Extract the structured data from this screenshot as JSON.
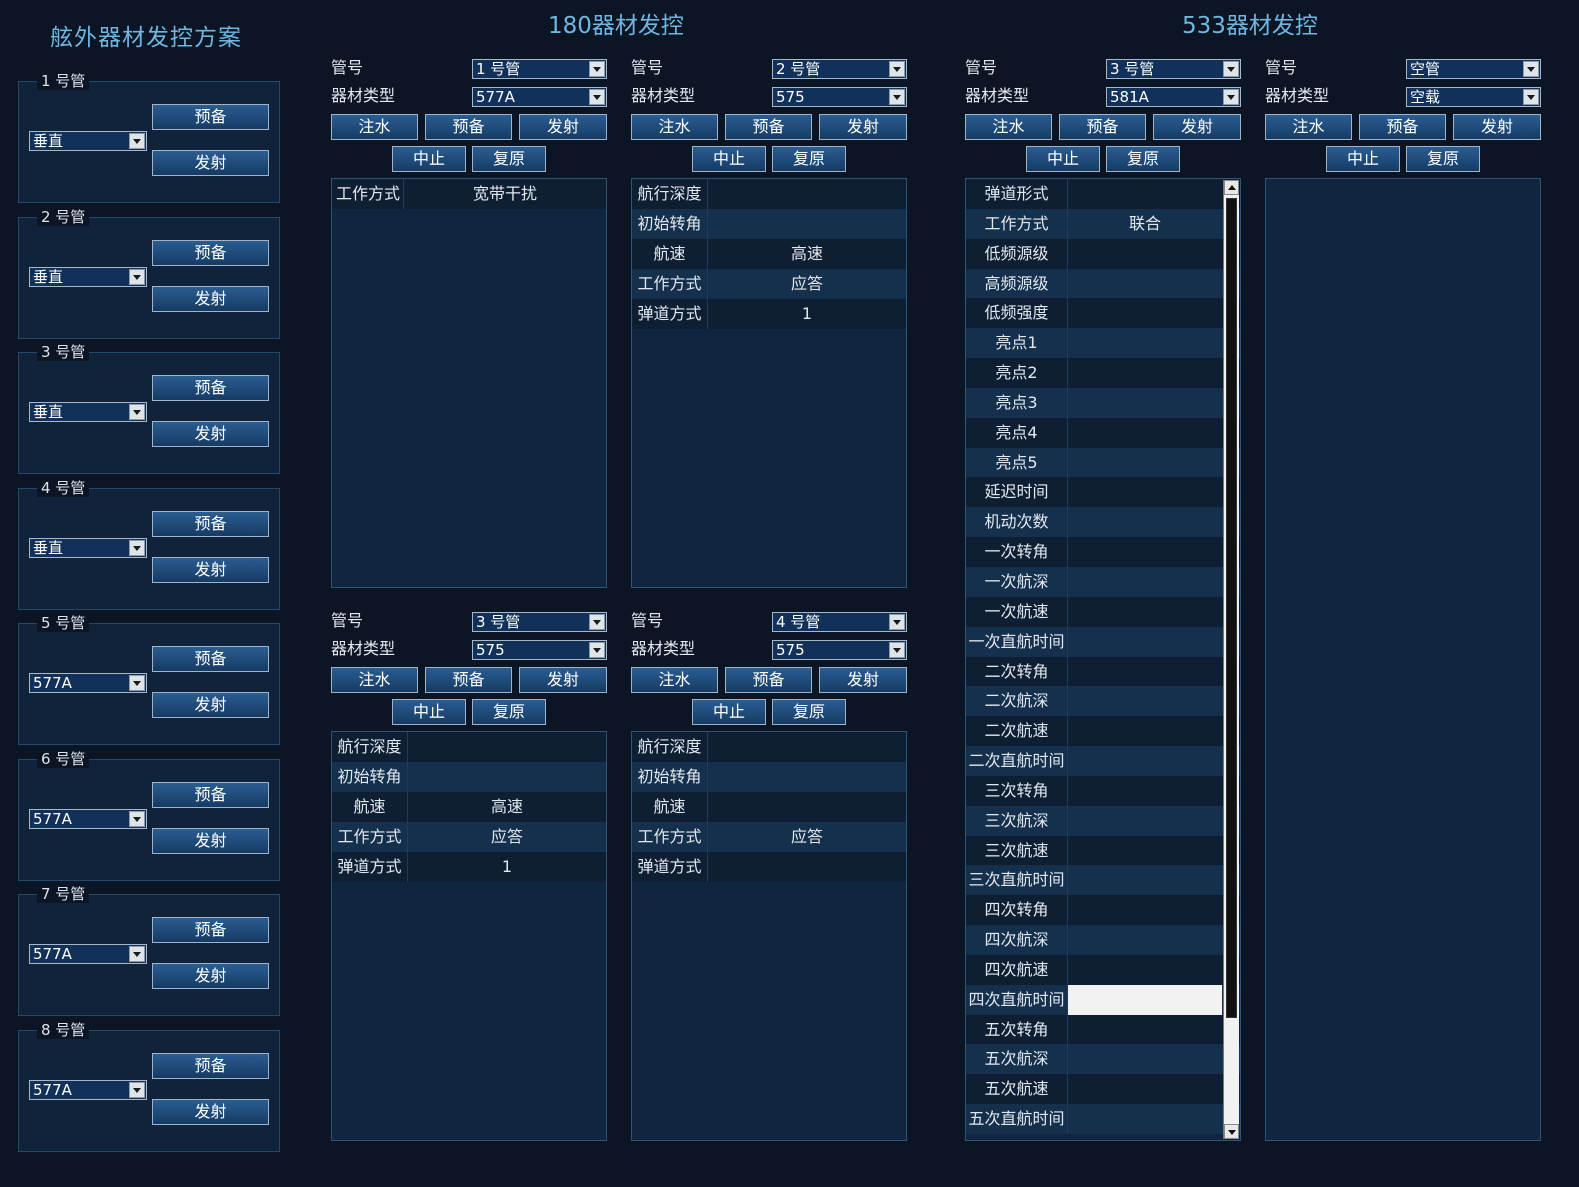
{
  "left_panel": {
    "title": "舷外器材发控方案",
    "tubes": [
      {
        "label": "1 号管",
        "mode": "垂直",
        "prepare": "预备",
        "launch": "发射"
      },
      {
        "label": "2 号管",
        "mode": "垂直",
        "prepare": "预备",
        "launch": "发射"
      },
      {
        "label": "3 号管",
        "mode": "垂直",
        "prepare": "预备",
        "launch": "发射"
      },
      {
        "label": "4 号管",
        "mode": "垂直",
        "prepare": "预备",
        "launch": "发射"
      },
      {
        "label": "5 号管",
        "mode": "577A",
        "prepare": "预备",
        "launch": "发射"
      },
      {
        "label": "6 号管",
        "mode": "577A",
        "prepare": "预备",
        "launch": "发射"
      },
      {
        "label": "7 号管",
        "mode": "577A",
        "prepare": "预备",
        "launch": "发射"
      },
      {
        "label": "8 号管",
        "mode": "577A",
        "prepare": "预备",
        "launch": "发射"
      }
    ]
  },
  "section_180": {
    "title": "180器材发控",
    "units": [
      {
        "tube_label": "管号",
        "tube_value": "1 号管",
        "type_label": "器材类型",
        "type_value": "577A",
        "fill": "注水",
        "prepare": "预备",
        "launch": "发射",
        "stop": "中止",
        "reset": "复原",
        "rows": [
          {
            "k": "工作方式",
            "v": "宽带干扰"
          }
        ]
      },
      {
        "tube_label": "管号",
        "tube_value": "2 号管",
        "type_label": "器材类型",
        "type_value": "575",
        "fill": "注水",
        "prepare": "预备",
        "launch": "发射",
        "stop": "中止",
        "reset": "复原",
        "rows": [
          {
            "k": "航行深度",
            "v": ""
          },
          {
            "k": "初始转角",
            "v": ""
          },
          {
            "k": "航速",
            "v": "高速"
          },
          {
            "k": "工作方式",
            "v": "应答"
          },
          {
            "k": "弹道方式",
            "v": "1"
          }
        ]
      },
      {
        "tube_label": "管号",
        "tube_value": "3 号管",
        "type_label": "器材类型",
        "type_value": "575",
        "fill": "注水",
        "prepare": "预备",
        "launch": "发射",
        "stop": "中止",
        "reset": "复原",
        "rows": [
          {
            "k": "航行深度",
            "v": ""
          },
          {
            "k": "初始转角",
            "v": ""
          },
          {
            "k": "航速",
            "v": "高速"
          },
          {
            "k": "工作方式",
            "v": "应答"
          },
          {
            "k": "弹道方式",
            "v": "1"
          }
        ]
      },
      {
        "tube_label": "管号",
        "tube_value": "4 号管",
        "type_label": "器材类型",
        "type_value": "575",
        "fill": "注水",
        "prepare": "预备",
        "launch": "发射",
        "stop": "中止",
        "reset": "复原",
        "rows": [
          {
            "k": "航行深度",
            "v": ""
          },
          {
            "k": "初始转角",
            "v": ""
          },
          {
            "k": "航速",
            "v": ""
          },
          {
            "k": "工作方式",
            "v": "应答"
          },
          {
            "k": "弹道方式",
            "v": ""
          }
        ]
      }
    ]
  },
  "section_533": {
    "title": "533器材发控",
    "units": [
      {
        "tube_label": "管号",
        "tube_value": "3 号管",
        "type_label": "器材类型",
        "type_value": "581A",
        "fill": "注水",
        "prepare": "预备",
        "launch": "发射",
        "stop": "中止",
        "reset": "复原"
      },
      {
        "tube_label": "管号",
        "tube_value": "空管",
        "type_label": "器材类型",
        "type_value": "空载",
        "fill": "注水",
        "prepare": "预备",
        "launch": "发射",
        "stop": "中止",
        "reset": "复原"
      }
    ],
    "params": [
      {
        "k": "弹道形式",
        "v": ""
      },
      {
        "k": "工作方式",
        "v": "联合"
      },
      {
        "k": "低频源级",
        "v": ""
      },
      {
        "k": "高频源级",
        "v": ""
      },
      {
        "k": "低频强度",
        "v": ""
      },
      {
        "k": "亮点1",
        "v": ""
      },
      {
        "k": "亮点2",
        "v": ""
      },
      {
        "k": "亮点3",
        "v": ""
      },
      {
        "k": "亮点4",
        "v": ""
      },
      {
        "k": "亮点5",
        "v": ""
      },
      {
        "k": "延迟时间",
        "v": ""
      },
      {
        "k": "机动次数",
        "v": ""
      },
      {
        "k": "一次转角",
        "v": ""
      },
      {
        "k": "一次航深",
        "v": ""
      },
      {
        "k": "一次航速",
        "v": ""
      },
      {
        "k": "一次直航时间",
        "v": ""
      },
      {
        "k": "二次转角",
        "v": ""
      },
      {
        "k": "二次航深",
        "v": ""
      },
      {
        "k": "二次航速",
        "v": ""
      },
      {
        "k": "二次直航时间",
        "v": ""
      },
      {
        "k": "三次转角",
        "v": ""
      },
      {
        "k": "三次航深",
        "v": ""
      },
      {
        "k": "三次航速",
        "v": ""
      },
      {
        "k": "三次直航时间",
        "v": ""
      },
      {
        "k": "四次转角",
        "v": ""
      },
      {
        "k": "四次航深",
        "v": ""
      },
      {
        "k": "四次航速",
        "v": ""
      },
      {
        "k": "四次直航时间",
        "v": ""
      },
      {
        "k": "五次转角",
        "v": ""
      },
      {
        "k": "五次航深",
        "v": ""
      },
      {
        "k": "五次航速",
        "v": ""
      },
      {
        "k": "五次直航时间",
        "v": ""
      }
    ],
    "active_param": "四次直航时间"
  }
}
